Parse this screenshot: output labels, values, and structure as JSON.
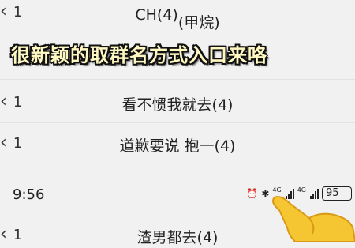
{
  "caption": "很新颖的取群名方式入口来咯",
  "rows": [
    {
      "back_count": "1",
      "title_main": "CH(4)",
      "title_sub": "(甲烷)"
    },
    {
      "back_count": "1",
      "title": "看不惯我就去(4)"
    },
    {
      "back_count": "1",
      "title": "道歉要说 抱一(4)"
    }
  ],
  "status_bar": {
    "time": "9:56",
    "network_1": "4G",
    "network_2": "4G",
    "battery": "95",
    "icons": [
      "alarm-icon",
      "bluetooth-icon",
      "signal-icon",
      "signal-icon",
      "battery-icon"
    ]
  },
  "bottom_row": {
    "back_count": "1",
    "title": "渣男都去(4)"
  },
  "colors": {
    "caption_fill": "#fff7c2",
    "caption_outline": "#111111",
    "background": "#f1f1f1",
    "hand": "#f6c532"
  }
}
